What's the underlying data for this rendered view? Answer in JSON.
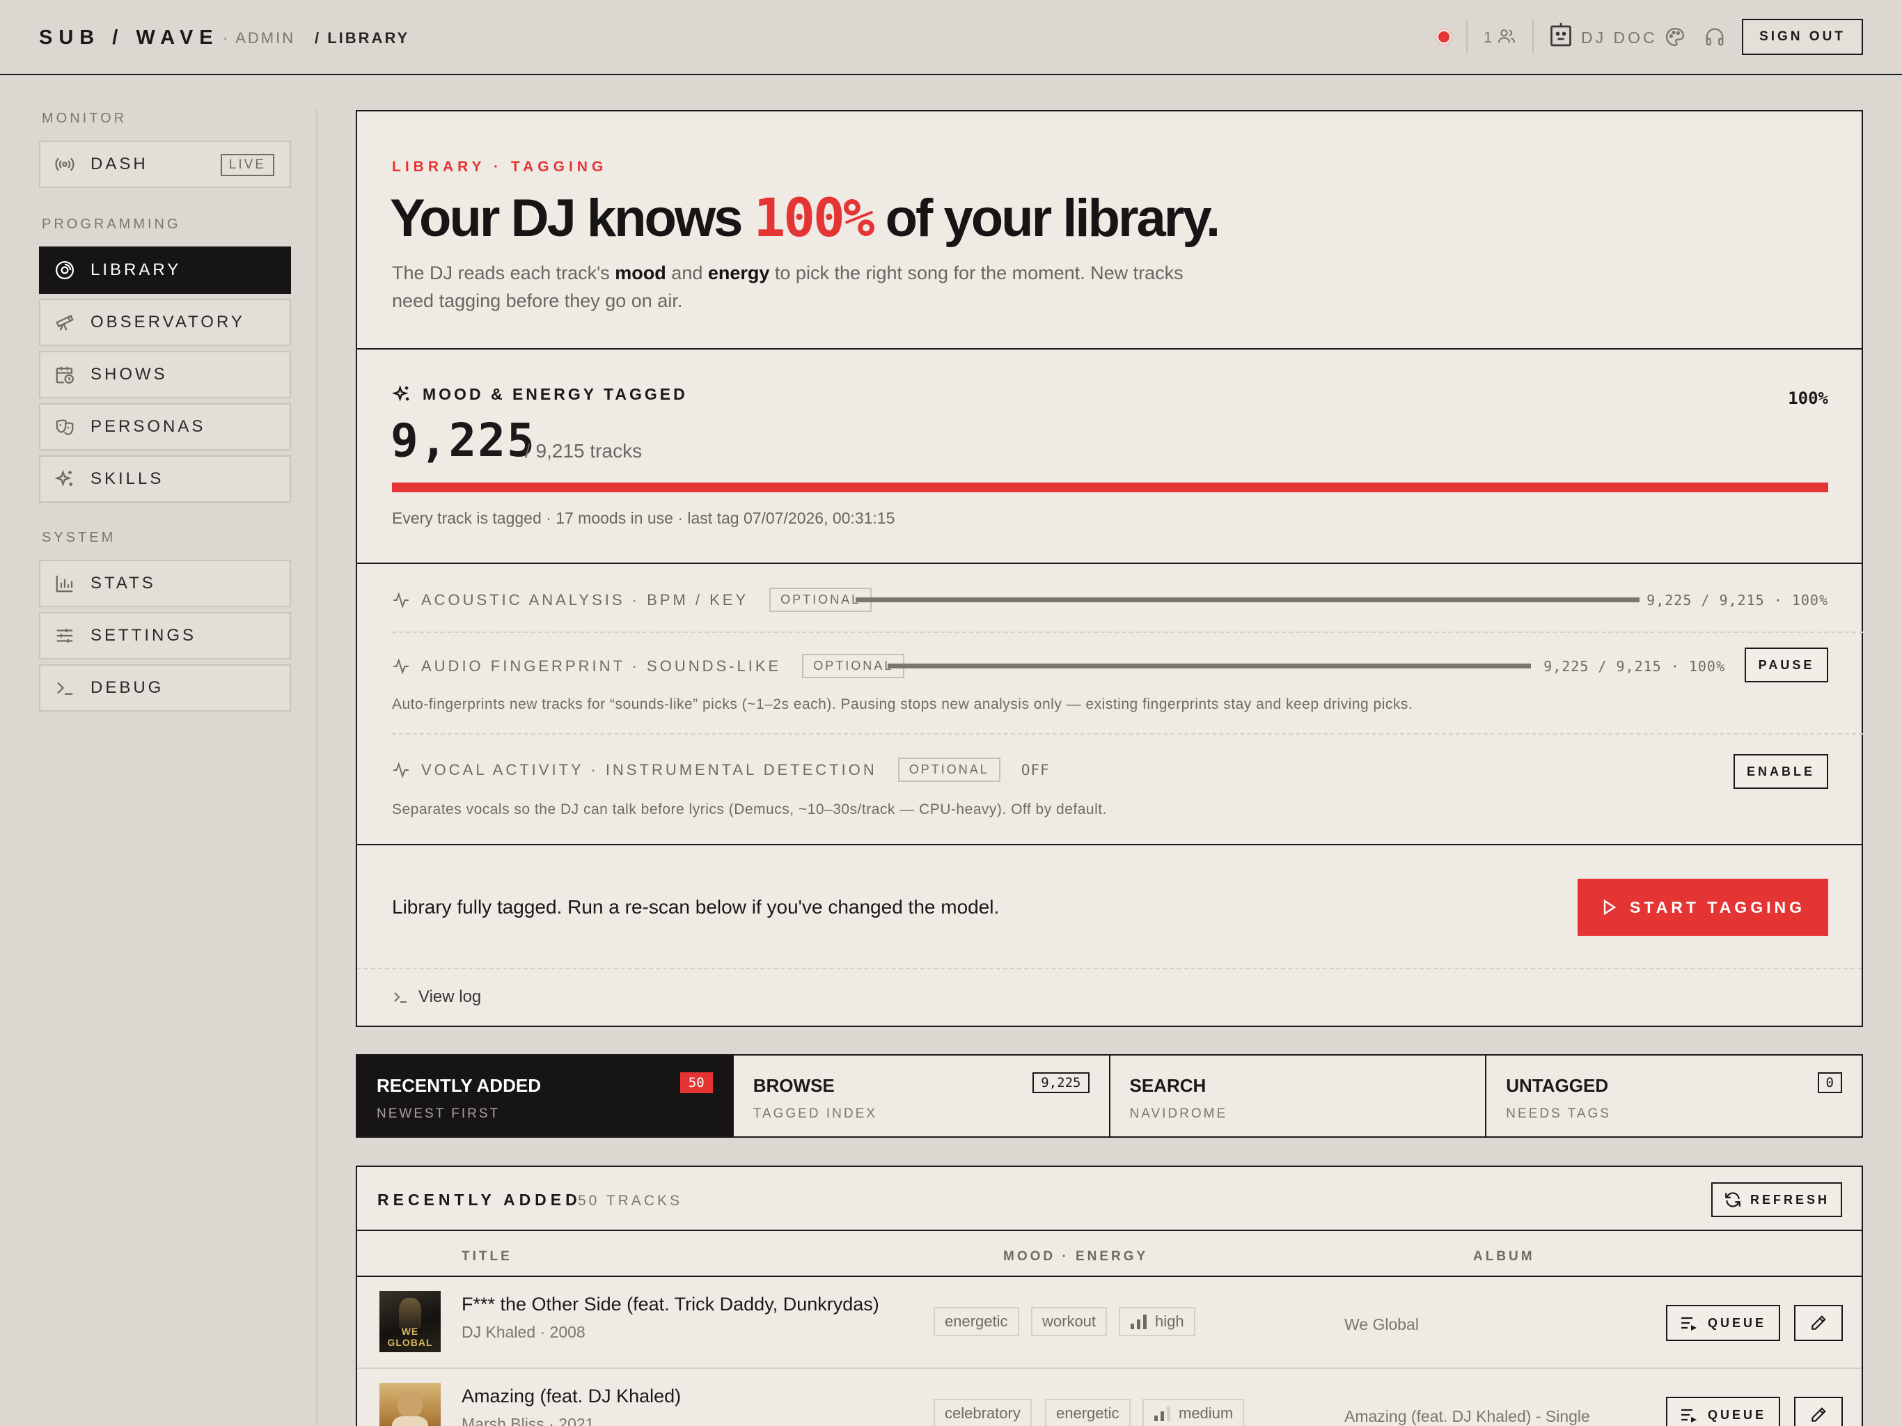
{
  "header": {
    "brand": "SUB / WAVE",
    "crumb_admin": "· ADMIN",
    "crumb_current": "/ LIBRARY",
    "listeners": "1",
    "dj_name": "DJ DOC",
    "sign_out": "SIGN OUT"
  },
  "sidebar": {
    "sections": {
      "monitor": "MONITOR",
      "programming": "PROGRAMMING",
      "system": "SYSTEM"
    },
    "dash": {
      "label": "DASH",
      "badge": "LIVE"
    },
    "library": "LIBRARY",
    "observatory": "OBSERVATORY",
    "shows": "SHOWS",
    "personas": "PERSONAS",
    "skills": "SKILLS",
    "stats": "STATS",
    "settings": "SETTINGS",
    "debug": "DEBUG"
  },
  "hero": {
    "kicker": "LIBRARY · TAGGING",
    "title_pre": "Your DJ knows ",
    "title_highlight": "100%",
    "title_post": " of your library.",
    "desc_1": "The DJ reads each track's ",
    "desc_mood": "mood",
    "desc_2": " and ",
    "desc_energy": "energy",
    "desc_3": " to pick the right song for the moment. New tracks need tagging before they go on air."
  },
  "mood": {
    "title": "MOOD & ENERGY TAGGED",
    "percent": "100%",
    "progress": 1.0,
    "count": "9,225",
    "total": "/ 9,215 tracks",
    "note": "Every track is tagged · 17 moods in use · last tag 07/07/2026, 00:31:15"
  },
  "analysis": {
    "acoustic": {
      "label": "ACOUSTIC ANALYSIS · BPM / KEY",
      "badge": "OPTIONAL",
      "value": "9,225 / 9,215 · 100%",
      "progress": 1.0
    },
    "fingerprint": {
      "label": "AUDIO FINGERPRINT · SOUNDS-LIKE",
      "badge": "OPTIONAL",
      "value": "9,225 / 9,215 · 100%",
      "progress": 1.0,
      "button": "PAUSE",
      "note": "Auto-fingerprints new tracks for “sounds-like” picks (~1–2s each). Pausing stops new analysis only — existing fingerprints stay and keep driving picks."
    },
    "vocal": {
      "label": "VOCAL ACTIVITY · INSTRUMENTAL DETECTION",
      "badge": "OPTIONAL",
      "status": "OFF",
      "button": "ENABLE",
      "note": "Separates vocals so the DJ can talk before lyrics (Demucs, ~10–30s/track — CPU-heavy). Off by default."
    }
  },
  "action": {
    "message": "Library fully tagged. Run a re-scan below if you've changed the model.",
    "start_button": "START TAGGING",
    "view_log": "View log"
  },
  "tabs": [
    {
      "label": "RECENTLY ADDED",
      "sub": "NEWEST FIRST",
      "count": "50"
    },
    {
      "label": "BROWSE",
      "sub": "TAGGED INDEX",
      "count": "9,225"
    },
    {
      "label": "SEARCH",
      "sub": "NAVIDROME",
      "count": ""
    },
    {
      "label": "UNTAGGED",
      "sub": "NEEDS TAGS",
      "count": "0"
    }
  ],
  "recent": {
    "title": "RECENTLY ADDED",
    "count": "50 TRACKS",
    "refresh": "REFRESH",
    "columns": {
      "title": "TITLE",
      "mood": "MOOD · ENERGY",
      "album": "ALBUM"
    },
    "queue_label": "QUEUE",
    "tracks": [
      {
        "title": "F*** the Other Side (feat. Trick Daddy, Dunkrydas)",
        "artist": "DJ Khaled · 2008",
        "tags": [
          "energetic",
          "workout"
        ],
        "energy": "high",
        "album": "We Global",
        "cover_text": "WE GLOBAL"
      },
      {
        "title": "Amazing (feat. DJ Khaled)",
        "artist": "Marsh Bliss · 2021",
        "tags": [
          "celebratory",
          "energetic"
        ],
        "energy": "medium",
        "album": "Amazing (feat. DJ Khaled) - Single",
        "cover_text": ""
      }
    ]
  },
  "colors": {
    "accent": "#e53434",
    "ink": "#161414",
    "paper": "#efebe4",
    "background": "#dcd8d1"
  }
}
